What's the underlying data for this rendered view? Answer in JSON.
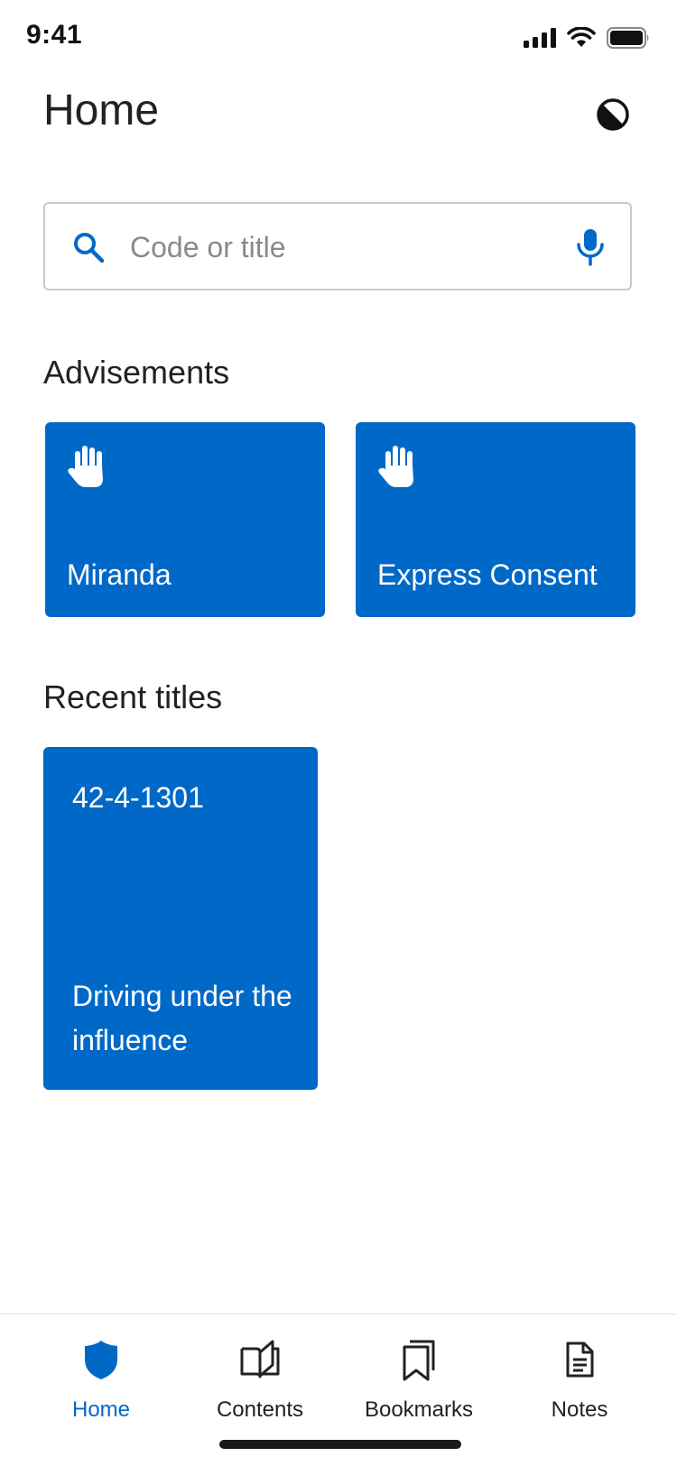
{
  "status_bar": {
    "time": "9:41"
  },
  "header": {
    "title": "Home"
  },
  "search": {
    "placeholder": "Code or title",
    "value": ""
  },
  "advisements": {
    "title": "Advisements",
    "items": [
      {
        "label": "Miranda",
        "icon": "hand-icon"
      },
      {
        "label": "Express Consent",
        "icon": "hand-icon"
      }
    ]
  },
  "recent": {
    "title": "Recent titles",
    "items": [
      {
        "code": "42-4-1301",
        "description": "Driving under the influence"
      }
    ]
  },
  "tabbar": {
    "items": [
      {
        "label": "Home",
        "icon": "shield-icon",
        "active": true
      },
      {
        "label": "Contents",
        "icon": "open-book-icon",
        "active": false
      },
      {
        "label": "Bookmarks",
        "icon": "bookmarks-icon",
        "active": false
      },
      {
        "label": "Notes",
        "icon": "note-icon",
        "active": false
      }
    ]
  },
  "colors": {
    "accent": "#0069c8",
    "text": "#222222",
    "border": "#c9c9c9"
  }
}
